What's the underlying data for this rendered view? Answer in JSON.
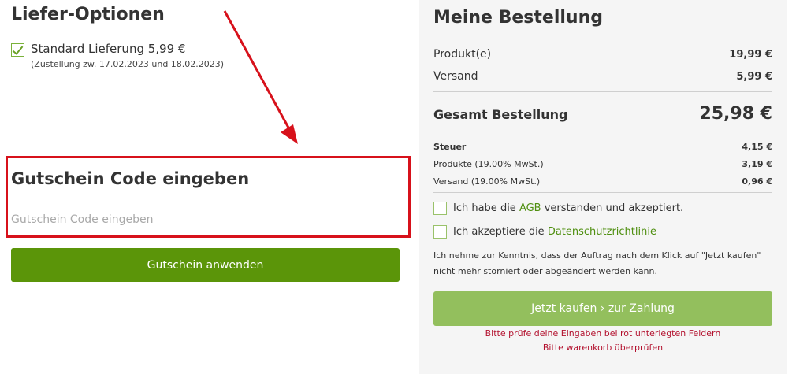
{
  "delivery": {
    "title": "Liefer-Optionen",
    "option_label": "Standard Lieferung 5,99 €",
    "option_sub": "(Zustellung zw. 17.02.2023 und 18.02.2023)",
    "option_checked": true
  },
  "voucher": {
    "title": "Gutschein Code eingeben",
    "placeholder": "Gutschein Code eingeben",
    "value": "",
    "button_label": "Gutschein anwenden"
  },
  "order": {
    "title": "Meine Bestellung",
    "products_label": "Produkt(e)",
    "products_value": "19,99 €",
    "shipping_label": "Versand",
    "shipping_value": "5,99 €",
    "total_label": "Gesamt Bestellung",
    "total_value": "25,98 €",
    "tax_label": "Steuer",
    "tax_value": "4,15 €",
    "tax_products_label": "Produkte (19.00% MwSt.)",
    "tax_products_value": "3,19 €",
    "tax_shipping_label": "Versand (19.00% MwSt.)",
    "tax_shipping_value": "0,96 €"
  },
  "consent": {
    "agb_prefix": "Ich habe die ",
    "agb_link": "AGB",
    "agb_suffix": " verstanden und akzeptiert.",
    "privacy_prefix": "Ich akzeptiere die ",
    "privacy_link": "Datenschutzrichtlinie",
    "notice_line1": "Ich nehme zur Kenntnis, dass der Auftrag nach dem Klick auf \"Jetzt kaufen\"",
    "notice_line2": "nicht mehr storniert oder abgeändert werden kann."
  },
  "checkout": {
    "button_label": "Jetzt kaufen › zur Zahlung",
    "error_line1": "Bitte prüfe deine Eingaben bei rot unterlegten Feldern",
    "error_line2": "Bitte warenkorb überprüfen"
  },
  "colors": {
    "accent_green": "#5b9509",
    "disabled_green": "#93bf5d",
    "highlight_red": "#d7111b",
    "error_red": "#b3112e"
  }
}
